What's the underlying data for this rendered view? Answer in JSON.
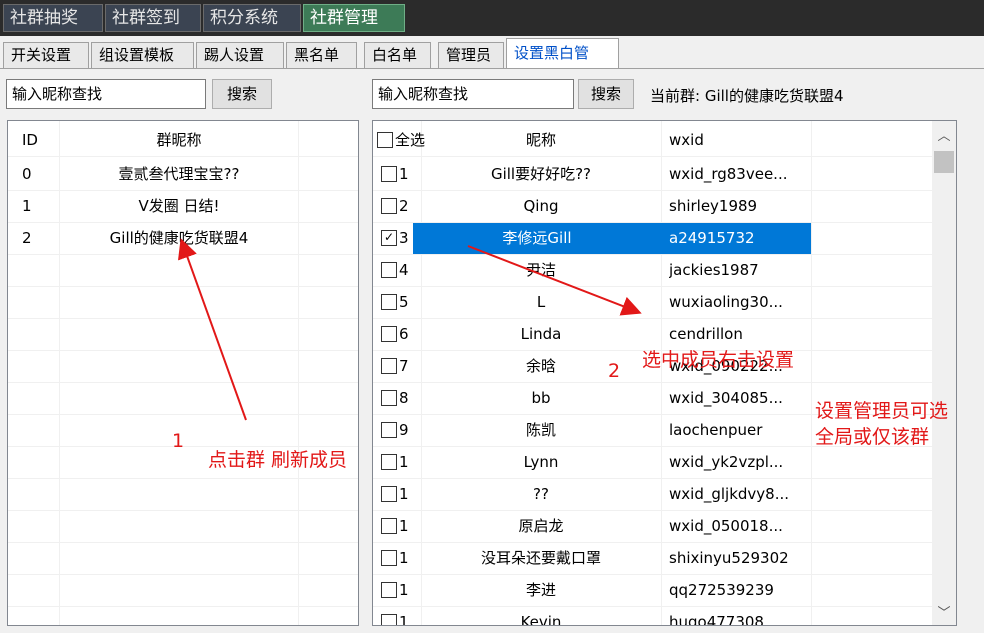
{
  "top_tabs": [
    "社群抽奖",
    "社群签到",
    "积分系统",
    "社群管理"
  ],
  "sub_tabs": [
    "开关设置",
    "组设置模板",
    "踢人设置",
    "黑名单",
    "白名单",
    "管理员",
    "设置黑白管"
  ],
  "left": {
    "search_value": "输入昵称查找",
    "search_button": "搜索",
    "headers": {
      "id": "ID",
      "name": "群昵称"
    },
    "groups": [
      {
        "id": "0",
        "name": "壹贰叁代理宝宝??"
      },
      {
        "id": "1",
        "name": "V发圈 日结!"
      },
      {
        "id": "2",
        "name": "Gill的健康吃货联盟4"
      }
    ]
  },
  "right": {
    "search_value": "输入昵称查找",
    "search_button": "搜索",
    "current_group": "当前群: Gill的健康吃货联盟4",
    "headers": {
      "select_all": "全选",
      "nick": "昵称",
      "wxid": "wxid"
    },
    "members": [
      {
        "idx": "1",
        "nick": "Gill要好好吃??",
        "wxid": "wxid_rg83vee...",
        "checked": false
      },
      {
        "idx": "2",
        "nick": "Qing",
        "wxid": "shirley1989",
        "checked": false
      },
      {
        "idx": "3",
        "nick": "李修远Gill",
        "wxid": "a24915732",
        "checked": true,
        "selected": true
      },
      {
        "idx": "4",
        "nick": "尹洁",
        "wxid": "jackies1987",
        "checked": false
      },
      {
        "idx": "5",
        "nick": "L",
        "wxid": "wuxiaoling30...",
        "checked": false
      },
      {
        "idx": "6",
        "nick": "Linda",
        "wxid": "cendrillon",
        "checked": false
      },
      {
        "idx": "7",
        "nick": "余晗",
        "wxid": "wxid_090222...",
        "checked": false
      },
      {
        "idx": "8",
        "nick": "bb",
        "wxid": "wxid_304085...",
        "checked": false
      },
      {
        "idx": "9",
        "nick": "陈凯",
        "wxid": "laochenpuer",
        "checked": false
      },
      {
        "idx": "1",
        "nick": "Lynn",
        "wxid": "wxid_yk2vzpl...",
        "checked": false
      },
      {
        "idx": "1",
        "nick": "??",
        "wxid": "wxid_gljkdvy8...",
        "checked": false
      },
      {
        "idx": "1",
        "nick": "原启龙",
        "wxid": "wxid_050018...",
        "checked": false
      },
      {
        "idx": "1",
        "nick": "没耳朵还要戴口罩",
        "wxid": "shixinyu529302",
        "checked": false
      },
      {
        "idx": "1",
        "nick": "李进",
        "wxid": "qq272539239",
        "checked": false
      },
      {
        "idx": "1",
        "nick": "Kevin",
        "wxid": "hugo477308",
        "checked": false
      }
    ]
  },
  "annotations": {
    "num1": "1",
    "note1": "点击群  刷新成员",
    "num2": "2",
    "note2": "选中成员右击设置",
    "note3_line1": "设置管理员可选",
    "note3_line2": "全局或仅该群"
  },
  "icons": {
    "scroll_up": "chevron-up-icon",
    "scroll_down": "chevron-down-icon",
    "check": "checkmark-icon"
  },
  "colors": {
    "selected_row": "#0078d7",
    "annotation": "#e21818",
    "active_top_tab": "#3d7b57"
  }
}
